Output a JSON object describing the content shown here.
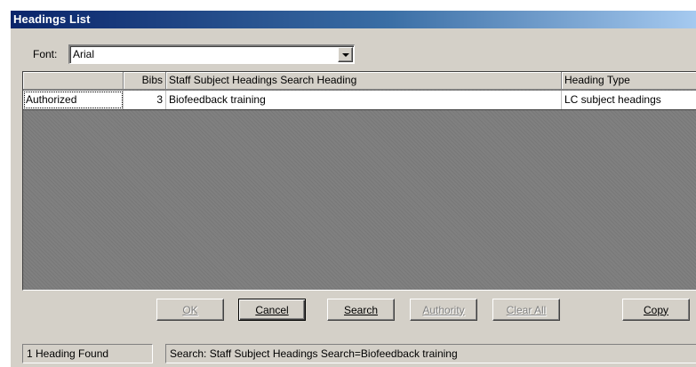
{
  "window": {
    "title": "Headings List"
  },
  "font": {
    "label": "Font:",
    "value": "Arial"
  },
  "grid": {
    "columns": [
      "",
      "Bibs",
      "Staff Subject Headings Search Heading",
      "Heading Type"
    ],
    "rows": [
      {
        "status": "Authorized",
        "bibs": "3",
        "heading": "Biofeedback training",
        "type": "LC subject headings"
      }
    ]
  },
  "buttons": {
    "ok": "OK",
    "cancel": "Cancel",
    "search": "Search",
    "authority": "Authority",
    "clear_all": "Clear All",
    "copy": "Copy"
  },
  "status": {
    "count": "1 Heading Found",
    "search": "Search: Staff Subject Headings Search=Biofeedback training"
  },
  "colors": {
    "face": "#d4d0c8",
    "title_start": "#0a246a",
    "title_end": "#a6caf0",
    "grid_background": "#808080"
  }
}
